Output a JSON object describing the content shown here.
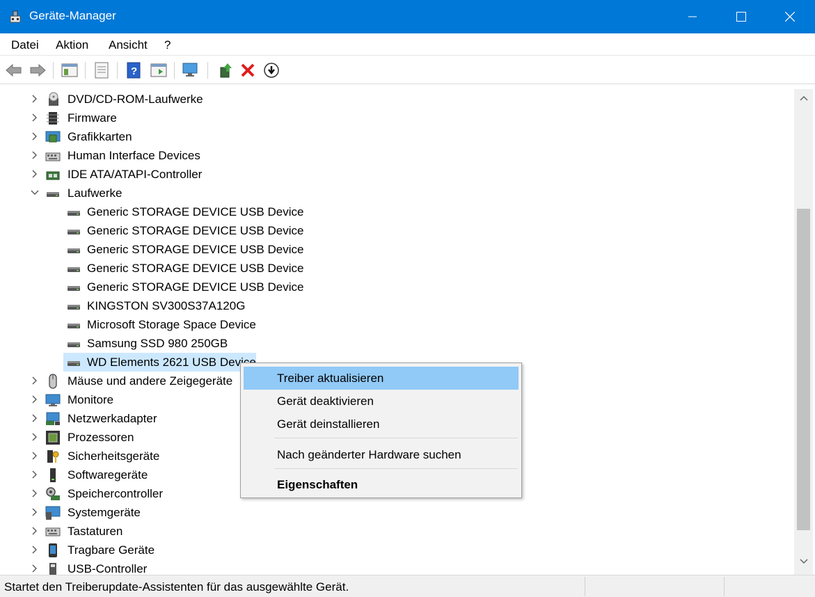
{
  "window": {
    "title": "Geräte-Manager"
  },
  "menu": [
    "Datei",
    "Aktion",
    "Ansicht",
    "?"
  ],
  "toolbar": [
    "back-icon",
    "forward-icon",
    "show-hide-tree-icon",
    "properties-icon",
    "help-icon",
    "run-icon",
    "monitor-icon",
    "update-driver-icon",
    "uninstall-icon",
    "scan-icon"
  ],
  "tree": {
    "categories_before": [
      {
        "label": "DVD/CD-ROM-Laufwerke",
        "icon": "dvd-drive-icon"
      },
      {
        "label": "Firmware",
        "icon": "firmware-chip-icon"
      },
      {
        "label": "Grafikkarten",
        "icon": "display-adapter-icon"
      },
      {
        "label": "Human Interface Devices",
        "icon": "hid-keyboard-icon"
      },
      {
        "label": "IDE ATA/ATAPI-Controller",
        "icon": "ide-controller-icon"
      }
    ],
    "expanded": {
      "label": "Laufwerke",
      "icon": "disk-drive-icon"
    },
    "children": [
      "Generic STORAGE DEVICE USB Device",
      "Generic STORAGE DEVICE USB Device",
      "Generic STORAGE DEVICE USB Device",
      "Generic STORAGE DEVICE USB Device",
      "Generic STORAGE DEVICE USB Device",
      "KINGSTON SV300S37A120G",
      "Microsoft Storage Space Device",
      "Samsung SSD 980 250GB",
      "WD Elements 2621 USB Device"
    ],
    "selected_child_index": 8,
    "categories_after": [
      {
        "label": "Mäuse und andere Zeigegeräte",
        "icon": "mouse-icon"
      },
      {
        "label": "Monitore",
        "icon": "monitor-icon"
      },
      {
        "label": "Netzwerkadapter",
        "icon": "network-adapter-icon"
      },
      {
        "label": "Prozessoren",
        "icon": "processor-icon"
      },
      {
        "label": "Sicherheitsgeräte",
        "icon": "security-device-icon"
      },
      {
        "label": "Softwaregeräte",
        "icon": "software-device-icon"
      },
      {
        "label": "Speichercontroller",
        "icon": "storage-controller-icon"
      },
      {
        "label": "Systemgeräte",
        "icon": "system-device-icon"
      },
      {
        "label": "Tastaturen",
        "icon": "keyboard-icon"
      },
      {
        "label": "Tragbare Geräte",
        "icon": "portable-device-icon"
      },
      {
        "label": "USB-Controller",
        "icon": "usb-controller-icon"
      }
    ]
  },
  "context_menu": {
    "items": [
      {
        "label": "Treiber aktualisieren",
        "highlighted": true
      },
      {
        "label": "Gerät deaktivieren"
      },
      {
        "label": "Gerät deinstallieren"
      },
      {
        "label": "Nach geänderter Hardware suchen"
      },
      {
        "label": "Eigenschaften",
        "bold": true
      }
    ]
  },
  "status": {
    "text": "Startet den Treiberupdate-Assistenten für das ausgewählte Gerät."
  },
  "colors": {
    "titlebar": "#0078d7",
    "selection": "#cce8ff",
    "menu_highlight": "#91c9f7"
  }
}
